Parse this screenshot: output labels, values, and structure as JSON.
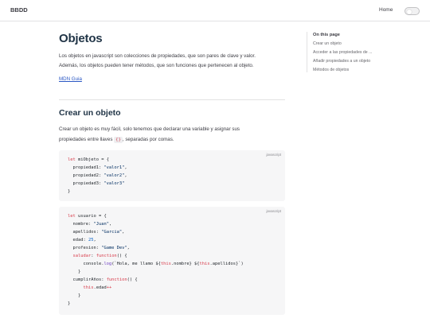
{
  "navbar": {
    "brand": "BBDD",
    "home_label": "Home"
  },
  "main": {
    "title": "Objetos",
    "intro_line1": "Los objetos en javascript son colecciones de propiedades, que son pares de clave y valor.",
    "intro_line2": "Además, los objetos pueden tener métodos, que son funciones que pertenecen al objeto.",
    "link_text": "MDN Guia",
    "section_title": "Crear un objeto",
    "section_text_1": "Crear un objeto es muy fácil, solo tenemos que declarar una variable y asignar sus",
    "section_text_2_before": "propiedades entre llaves ",
    "section_text_code": "{}",
    "section_text_2_after": ", separadas por comas."
  },
  "code_blocks": [
    {
      "language": "javascript",
      "lines": [
        [
          [
            "kw",
            "let"
          ],
          [
            "txt",
            " miObjeto = {"
          ]
        ],
        [
          [
            "txt",
            "  propiedad1: "
          ],
          [
            "str",
            "\"valor1\""
          ],
          [
            "txt",
            ","
          ]
        ],
        [
          [
            "txt",
            "  propiedad2: "
          ],
          [
            "str",
            "\"valor2\""
          ],
          [
            "txt",
            ","
          ]
        ],
        [
          [
            "txt",
            "  propiedad3: "
          ],
          [
            "str",
            "\"valor3\""
          ]
        ],
        [
          [
            "txt",
            "}"
          ]
        ]
      ]
    },
    {
      "language": "javascript",
      "lines": [
        [
          [
            "kw",
            "let"
          ],
          [
            "txt",
            " usuario = {"
          ]
        ],
        [
          [
            "txt",
            "  nombre: "
          ],
          [
            "str",
            "\"Juan\""
          ],
          [
            "txt",
            ","
          ]
        ],
        [
          [
            "txt",
            "  apellidos: "
          ],
          [
            "str",
            "\"Garcia\""
          ],
          [
            "txt",
            ","
          ]
        ],
        [
          [
            "txt",
            "  edad: "
          ],
          [
            "num",
            "25"
          ],
          [
            "txt",
            ","
          ]
        ],
        [
          [
            "txt",
            "  profesion: "
          ],
          [
            "str",
            "\"Game Dev\""
          ],
          [
            "txt",
            ","
          ]
        ],
        [
          [
            "txt",
            "  "
          ],
          [
            "kw",
            "saludar"
          ],
          [
            "txt",
            ": "
          ],
          [
            "kw",
            "function"
          ],
          [
            "txt",
            "() {"
          ]
        ],
        [
          [
            "txt",
            "      console."
          ],
          [
            "fn",
            "log"
          ],
          [
            "txt",
            "(`Hola, me llamo ${"
          ],
          [
            "kw",
            "this"
          ],
          [
            "txt",
            ".nombre} ${"
          ],
          [
            "kw",
            "this"
          ],
          [
            "txt",
            ".apellidos}`)"
          ]
        ],
        [
          [
            "txt",
            "    }"
          ]
        ],
        [
          [
            "txt",
            "  cumplirAños: "
          ],
          [
            "kw",
            "function"
          ],
          [
            "txt",
            "() {"
          ]
        ],
        [
          [
            "txt",
            "      "
          ],
          [
            "kw",
            "this"
          ],
          [
            "txt",
            ".edad"
          ],
          [
            "kw",
            "++"
          ]
        ],
        [
          [
            "txt",
            "    }"
          ]
        ],
        [
          [
            "txt",
            "}"
          ]
        ]
      ]
    }
  ],
  "toc": {
    "title": "On this page",
    "items": [
      "Crear un objeto",
      "Acceder a las propiedades de ...",
      "Añadir propiedades a un objeto",
      "Métodos de objetos"
    ]
  },
  "colors": {
    "keyword": "#d73a49",
    "string": "#032f62",
    "number": "#005cc5",
    "link": "#2b58c4"
  }
}
